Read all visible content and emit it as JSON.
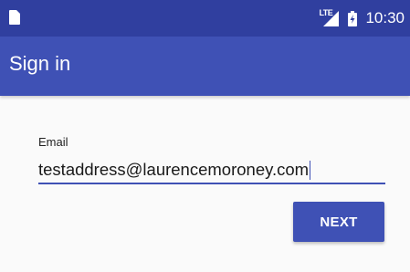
{
  "status_bar": {
    "sim_icon": "sim-card-icon",
    "network_label": "LTE",
    "signal_icon": "cell-signal-icon",
    "battery_icon": "battery-charging-icon",
    "time": "10:30"
  },
  "app_bar": {
    "title": "Sign in"
  },
  "form": {
    "email_label": "Email",
    "email_value": "testaddress@laurencemoroney.com",
    "next_label": "NEXT"
  },
  "colors": {
    "status_bar": "#303f9f",
    "primary": "#3f51b5",
    "background": "#fafafa"
  }
}
